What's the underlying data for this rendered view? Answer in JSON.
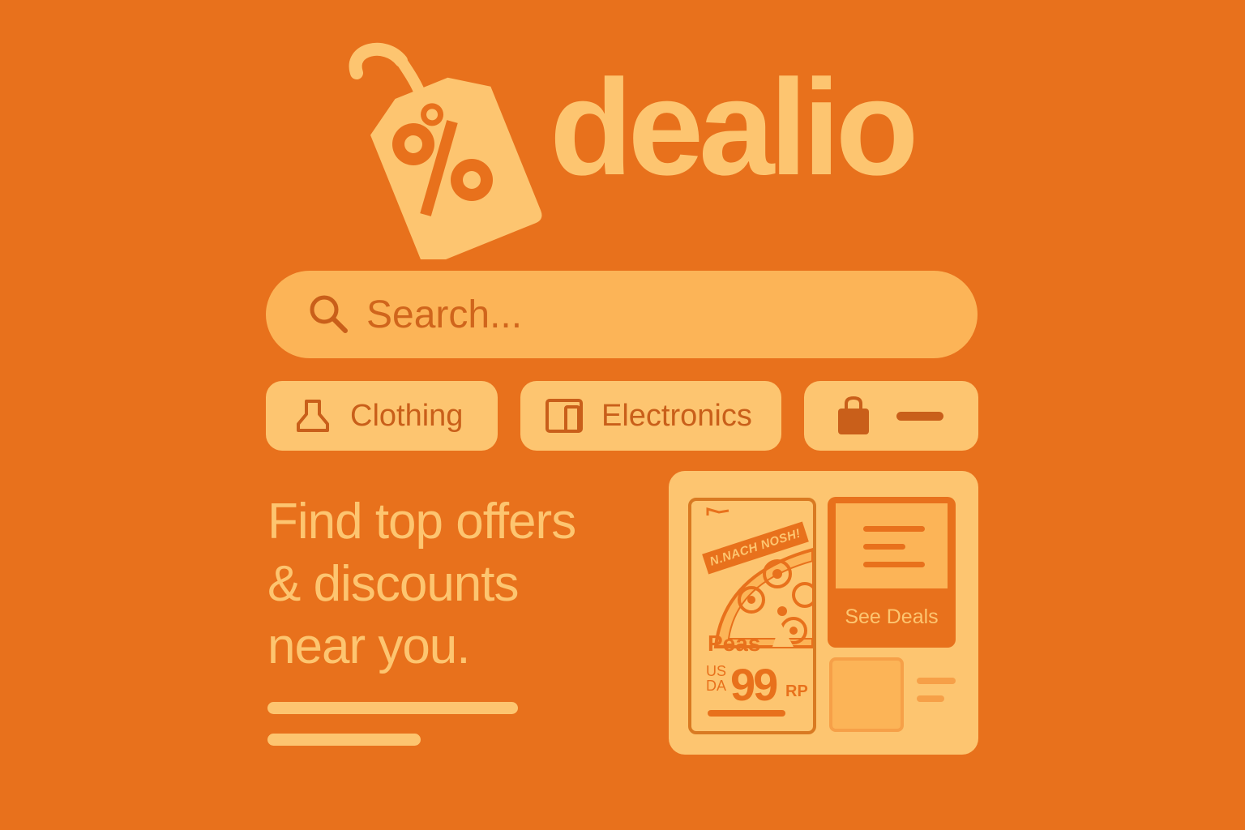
{
  "brand": {
    "name": "dealio",
    "logo_icon": "percent-tag-icon"
  },
  "search": {
    "placeholder": "Search...",
    "value": "",
    "icon": "search-icon"
  },
  "categories": [
    {
      "label": "Clothing",
      "icon": "clothing-icon"
    },
    {
      "label": "Electronics",
      "icon": "devices-icon"
    },
    {
      "label": "",
      "icon": "shopping-bag-icon"
    }
  ],
  "tagline": {
    "line1": "Find top offers",
    "line2": "& discounts",
    "line3": "near you."
  },
  "deals_panel": {
    "promo": {
      "banner": "N.NACH NOSH!",
      "name": "Peas",
      "currency_top": "US",
      "currency_bottom": "DA",
      "price": "99",
      "unit": "RP"
    },
    "see_deals_label": "See Deals"
  },
  "colors": {
    "background": "#E8711C",
    "accent_light": "#FDC570",
    "accent_mid": "#FCB457",
    "text_dark": "#C95F1A"
  }
}
